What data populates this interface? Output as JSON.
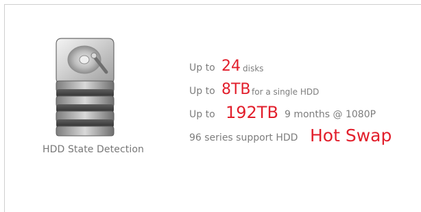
{
  "feature": {
    "caption": "HDD State Detection",
    "icon": "hard-drive-stack-icon",
    "accent_color": "#e21f2c",
    "text_color": "#777777"
  },
  "specs": [
    {
      "prefix": "Up to",
      "value": "24",
      "suffix": "disks"
    },
    {
      "prefix": "Up to",
      "value": "8TB",
      "suffix": "for a single HDD"
    },
    {
      "prefix": "Up to",
      "value": "192TB",
      "suffix": "9 months @ 1080P"
    },
    {
      "prefix": "96 series support HDD",
      "value": "Hot Swap",
      "suffix": ""
    }
  ]
}
